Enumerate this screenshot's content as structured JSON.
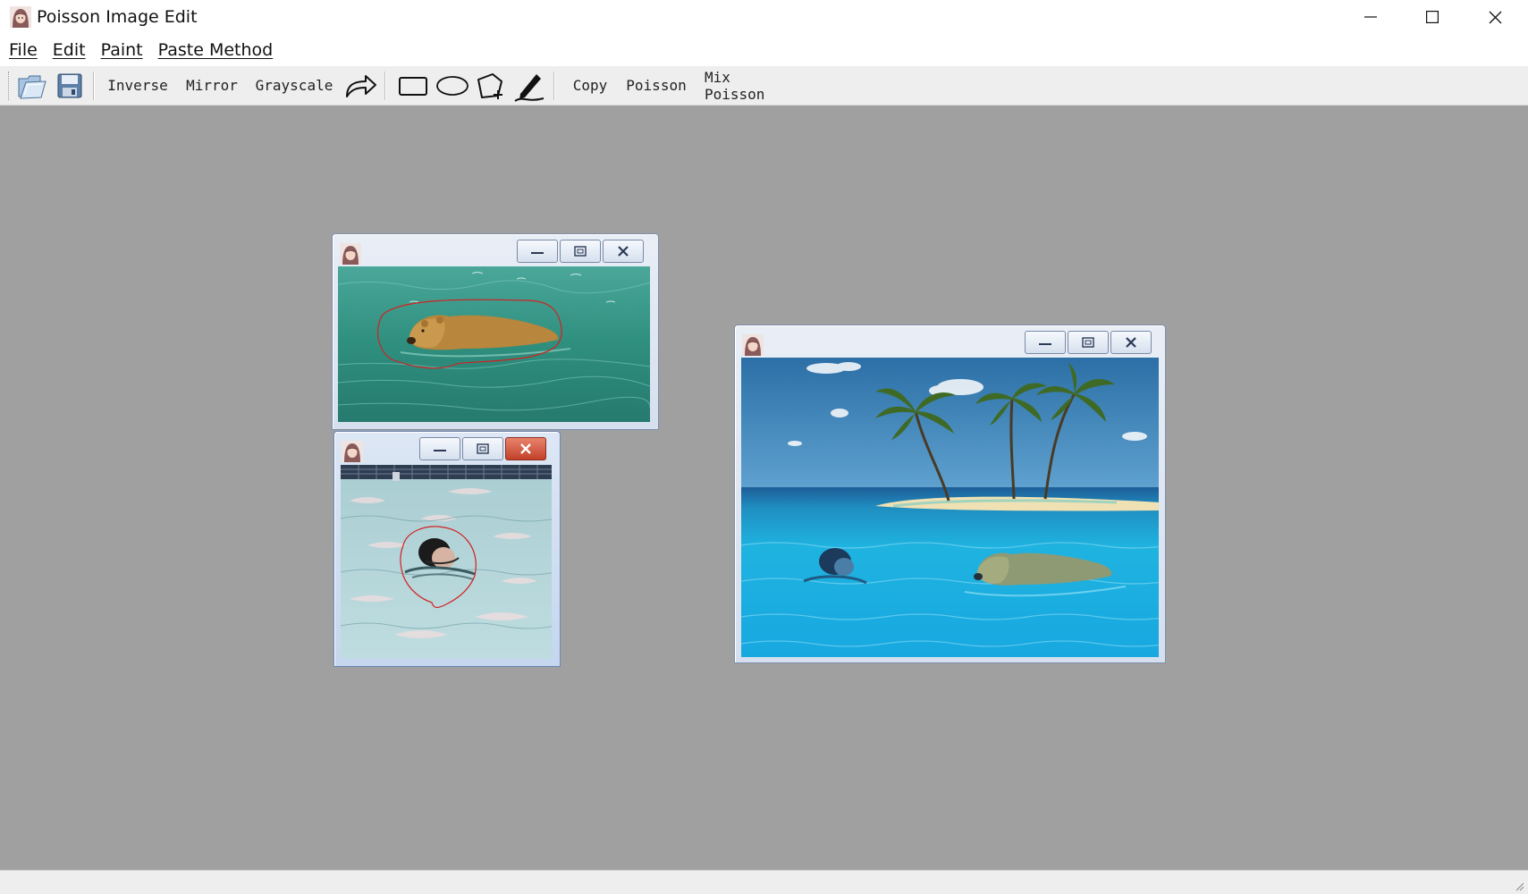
{
  "window": {
    "title": "Poisson Image Edit"
  },
  "menu": {
    "items": [
      {
        "label": "File"
      },
      {
        "label": "Edit"
      },
      {
        "label": "Paint"
      },
      {
        "label": "Paste Method"
      }
    ]
  },
  "toolbar": {
    "inverse_label": "Inverse",
    "mirror_label": "Mirror",
    "grayscale_label": "Grayscale",
    "copy_label": "Copy",
    "poisson_label": "Poisson",
    "mix_poisson_label": "Mix Poisson",
    "icons": [
      "open-folder-icon",
      "save-disk-icon",
      "redo-arrow-icon",
      "rectangle-tool-icon",
      "ellipse-tool-icon",
      "polygon-tool-icon",
      "pen-tool-icon"
    ]
  },
  "frames": [
    {
      "name": "bear-source-frame",
      "image": "bear swimming in green water with red selection outline"
    },
    {
      "name": "swimmer-source-frame",
      "image": "swimmer head in pool with red selection outline"
    },
    {
      "name": "result-frame",
      "image": "tropical island with palm trees, swimmer and bear pasted into blue water"
    }
  ],
  "colors": {
    "desktop": "#a0a0a0",
    "toolbar": "#eeeeee",
    "selection_outline": "#d42020",
    "frame_close_active": "#c2412a"
  }
}
